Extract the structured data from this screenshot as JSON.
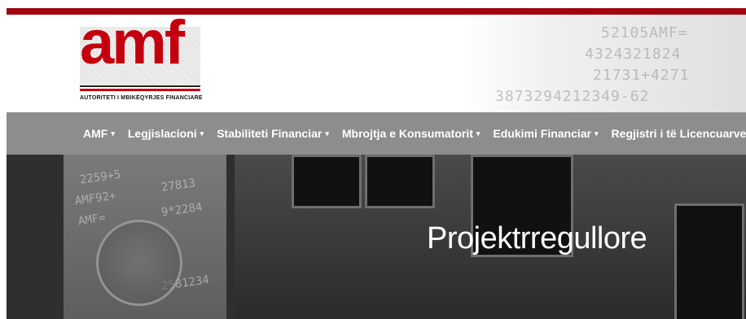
{
  "header": {
    "logo_text": "amf",
    "logo_caption": "AUTORITETI I MBIKËQYRJES FINANCIARE",
    "background_art_lines": [
      "52105AMF=",
      "4324321824",
      "21731+4271",
      "3873294212349-62"
    ]
  },
  "nav": {
    "items": [
      {
        "label": "AMF",
        "caret": "▾"
      },
      {
        "label": "Legjislacioni",
        "caret": "▾"
      },
      {
        "label": "Stabiliteti Financiar",
        "caret": "▾"
      },
      {
        "label": "Mbrojtja e Konsumatorit",
        "caret": "▾"
      },
      {
        "label": "Edukimi Financiar",
        "caret": "▾"
      },
      {
        "label": "Regjistri i të Licencuarve",
        "caret": "▾"
      }
    ]
  },
  "hero": {
    "title": "Projektrregullore",
    "background_numbers": [
      "2259+5",
      "AMF92+",
      "AMF=",
      "27813",
      "9*2284",
      "2581234"
    ]
  },
  "colors": {
    "brand_red": "#a1050e",
    "logo_red": "#c4000f",
    "nav_bg": "#8d8d8d",
    "hero_bg": "#2f2f2f"
  }
}
